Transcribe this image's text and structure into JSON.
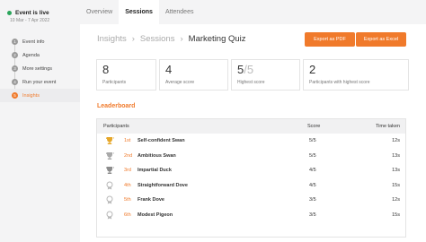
{
  "event": {
    "status": "Event is live",
    "dates": "10 Mar - 7 Apr 2022",
    "status_color": "#2aa55b"
  },
  "steps": [
    {
      "num": "1",
      "label": "Event info",
      "active": false
    },
    {
      "num": "2",
      "label": "Agenda",
      "active": false
    },
    {
      "num": "3",
      "label": "More settings",
      "active": false
    },
    {
      "num": "4",
      "label": "Run your event",
      "active": false
    },
    {
      "num": "5",
      "label": "Insights",
      "active": true
    }
  ],
  "tabs": [
    {
      "label": "Overview",
      "active": false
    },
    {
      "label": "Sessions",
      "active": true
    },
    {
      "label": "Attendees",
      "active": false
    }
  ],
  "breadcrumb": [
    "Insights",
    "Sessions",
    "Marketing Quiz"
  ],
  "buttons": {
    "pdf": "Export as PDF",
    "excel": "Export as Excel"
  },
  "stats": [
    {
      "value": "8",
      "label": "Participants"
    },
    {
      "value": "4",
      "label": "Average score"
    },
    {
      "value": "5",
      "value_total": "/5",
      "label": "Highest score"
    },
    {
      "value": "2",
      "label": "Participants with highest score"
    }
  ],
  "leaderboard": {
    "title": "Leaderboard",
    "columns": {
      "participants": "Participants",
      "score": "Score",
      "time": "Time taken"
    },
    "rows": [
      {
        "rank": "1st",
        "name": "Self-confident Swan",
        "score": "5/5",
        "time": "12s",
        "trophy": "gold"
      },
      {
        "rank": "2nd",
        "name": "Ambitious Swan",
        "score": "5/5",
        "time": "13s",
        "trophy": "silver"
      },
      {
        "rank": "3rd",
        "name": "Impartial Duck",
        "score": "4/5",
        "time": "13s",
        "trophy": "bronze"
      },
      {
        "rank": "4th",
        "name": "Straightforward Dove",
        "score": "4/5",
        "time": "15s",
        "trophy": "badge"
      },
      {
        "rank": "5th",
        "name": "Frank Dove",
        "score": "3/5",
        "time": "12s",
        "trophy": "badge"
      },
      {
        "rank": "6th",
        "name": "Modest Pigeon",
        "score": "3/5",
        "time": "15s",
        "trophy": "badge"
      }
    ]
  },
  "colors": {
    "accent": "#f07a2b",
    "gold": "#e6a72a",
    "silver": "#a9a9a9",
    "bronze": "#8d8d8d",
    "badge": "#b7b7b7"
  }
}
